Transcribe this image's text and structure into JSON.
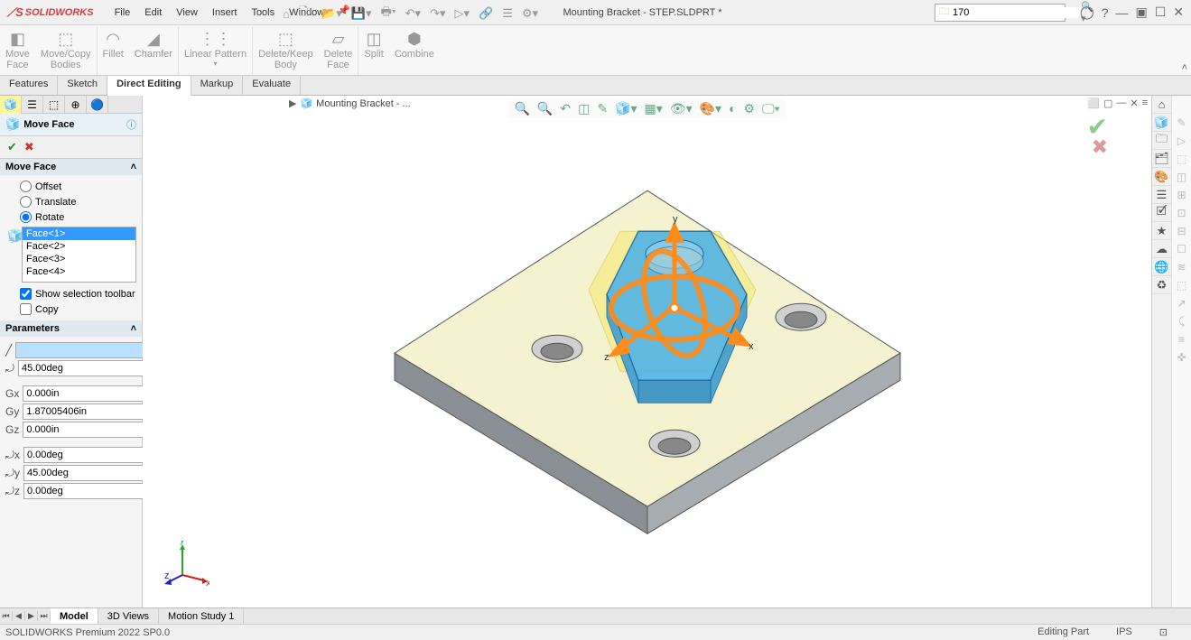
{
  "app": {
    "logo_text": "SOLIDWORKS",
    "doc_title": "Mounting Bracket - STEP.SLDPRT *"
  },
  "menubar": [
    "File",
    "Edit",
    "View",
    "Insert",
    "Tools",
    "Window"
  ],
  "search": {
    "value": "170",
    "dropdown": "▾"
  },
  "ribbon": {
    "groups": [
      {
        "buttons": [
          {
            "label": "Move\nFace"
          },
          {
            "label": "Move/Copy\nBodies"
          }
        ]
      },
      {
        "buttons": [
          {
            "label": "Fillet"
          },
          {
            "label": "Chamfer"
          }
        ]
      },
      {
        "buttons": [
          {
            "label": "Linear Pattern"
          }
        ]
      },
      {
        "buttons": [
          {
            "label": "Delete/Keep\nBody"
          },
          {
            "label": "Delete\nFace"
          }
        ]
      },
      {
        "buttons": [
          {
            "label": "Split"
          },
          {
            "label": "Combine"
          }
        ]
      }
    ]
  },
  "cm_tabs": [
    "Features",
    "Sketch",
    "Direct Editing",
    "Markup",
    "Evaluate"
  ],
  "cm_active": "Direct Editing",
  "breadcrumb": "Mounting Bracket - ...",
  "pm": {
    "title": "Move Face",
    "section1_title": "Move Face",
    "options": {
      "offset": "Offset",
      "translate": "Translate",
      "rotate": "Rotate",
      "selected": "rotate"
    },
    "faces": [
      "Face<1>",
      "Face<2>",
      "Face<3>",
      "Face<4>"
    ],
    "show_toolbar_label": "Show selection toolbar",
    "show_toolbar_checked": true,
    "copy_label": "Copy",
    "copy_checked": false,
    "section2_title": "Parameters",
    "params": {
      "axis_ref": "",
      "angle": "45.00deg",
      "cx": "0.000in",
      "cy": "1.87005406in",
      "cz": "0.000in",
      "rx": "0.00deg",
      "ry": "45.00deg",
      "rz": "0.00deg"
    }
  },
  "axes": {
    "x": "x",
    "y": "y",
    "z": "z"
  },
  "bottom_tabs": [
    "Model",
    "3D Views",
    "Motion Study 1"
  ],
  "bottom_active": "Model",
  "status": {
    "left": "SOLIDWORKS Premium 2022 SP0.0",
    "mode": "Editing Part",
    "units": "IPS"
  }
}
